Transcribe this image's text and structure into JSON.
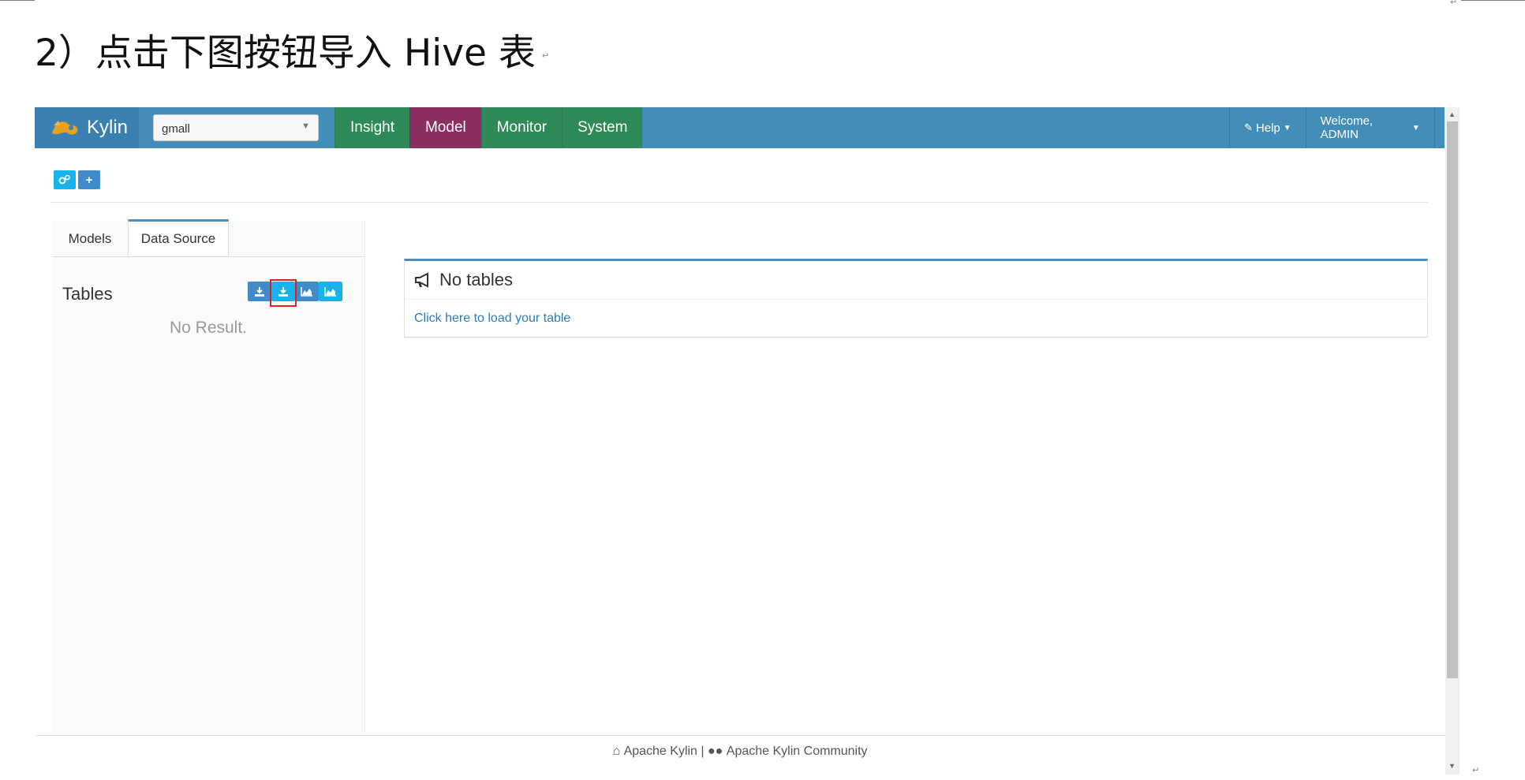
{
  "doc": {
    "heading": "2）点击下图按钮导入 Hive 表",
    "paragraph_mark": "↵"
  },
  "app": {
    "brand": "Kylin",
    "project_select": {
      "value": "gmall"
    },
    "nav": [
      {
        "label": "Insight",
        "active": false
      },
      {
        "label": "Model",
        "active": true
      },
      {
        "label": "Monitor",
        "active": false
      },
      {
        "label": "System",
        "active": false
      }
    ],
    "nav_right": {
      "help": "Help",
      "welcome": "Welcome, ADMIN"
    },
    "toolbar": {
      "settings_icon": "gears-icon",
      "add_icon": "plus-icon",
      "add_label": "+"
    },
    "tabs": [
      "Models",
      "Data Source"
    ],
    "active_tab": "Data Source",
    "tables_title": "Tables",
    "no_result": "No Result.",
    "datasource_buttons": [
      {
        "icon": "download-icon",
        "color": "#428bca"
      },
      {
        "icon": "download-icon",
        "color": "#1ab2ea",
        "highlighted": true
      },
      {
        "icon": "area-chart-icon",
        "color": "#428bca"
      },
      {
        "icon": "area-chart-icon",
        "color": "#1ab2ea"
      }
    ],
    "content": {
      "title": "No tables",
      "link": "Click here to load your table"
    },
    "footer": {
      "home_text": "Apache Kylin",
      "separator": "|",
      "community_text": "Apache Kylin Community"
    },
    "colors": {
      "navbar": "#438eb9",
      "nav_item": "#2e8b57",
      "nav_active": "#8b2f62",
      "accent": "#4c8fbd",
      "highlight": "#e21d1d"
    }
  }
}
